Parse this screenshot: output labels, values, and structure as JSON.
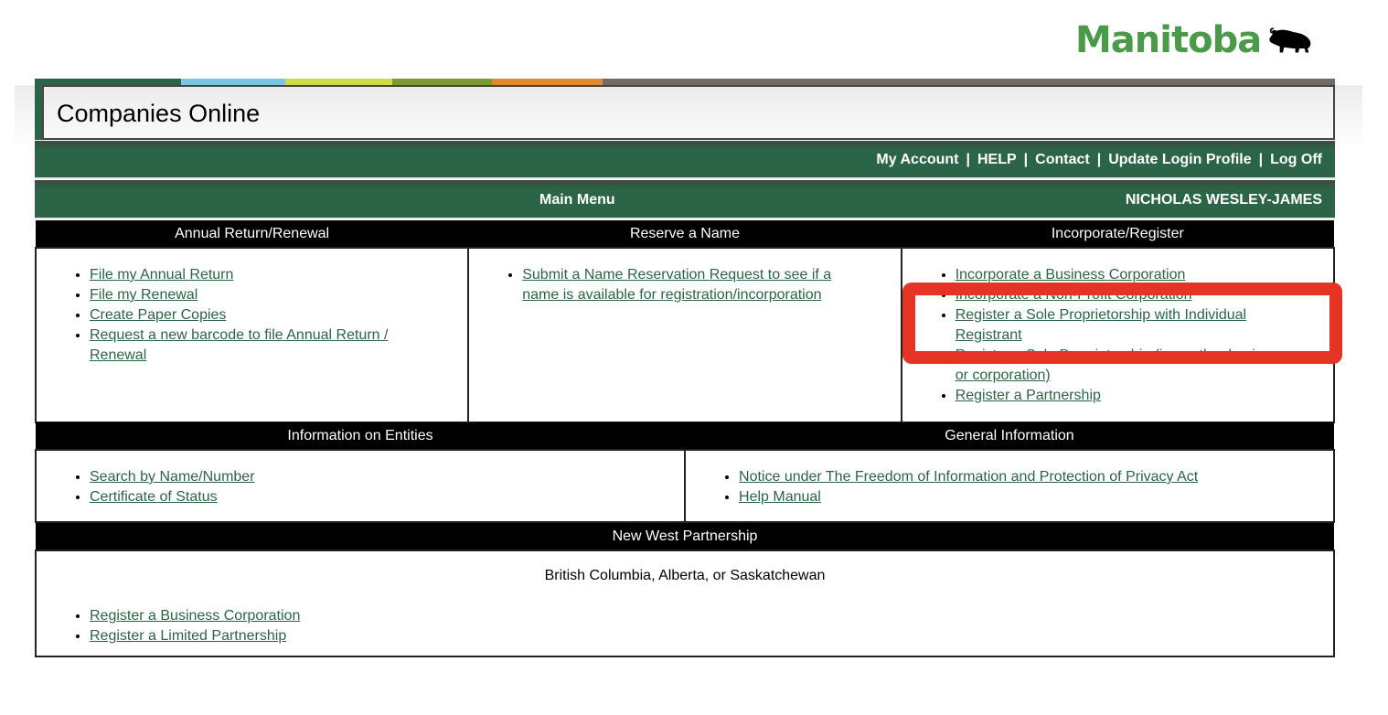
{
  "brand": {
    "logo_text": "Manitoba",
    "logo_icon": "bison-icon",
    "stripe_colors": [
      "#2c6447",
      "#7ac4e4",
      "#cfdc48",
      "#7d9a34",
      "#e08a30",
      "#736a63"
    ]
  },
  "app_title": "Companies Online",
  "top_links": [
    "My Account",
    "HELP",
    "Contact",
    "Update Login Profile",
    "Log Off"
  ],
  "menu_bar": {
    "title": "Main Menu",
    "user_name": "NICHOLAS WESLEY-JAMES"
  },
  "sections_row1": [
    {
      "header": "Annual Return/Renewal",
      "links": [
        "File my Annual Return",
        "File my Renewal",
        "Create Paper Copies",
        "Request a new barcode to file Annual Return / Renewal"
      ]
    },
    {
      "header": "Reserve a Name",
      "links": [
        "Submit a Name Reservation Request to see if a name is available for registration/incorporation"
      ]
    },
    {
      "header": "Incorporate/Register",
      "links": [
        "Incorporate a Business Corporation",
        "Incorporate a Non-Profit Corporation",
        "Register a Sole Proprietorship with Individual Registrant",
        "Register a Sole Proprietorship (in another business or corporation)",
        "Register a Partnership"
      ]
    }
  ],
  "sections_row2": [
    {
      "header": "Information on Entities",
      "links": [
        "Search by Name/Number",
        "Certificate of Status"
      ]
    },
    {
      "header": "General Information",
      "links": [
        "Notice under The Freedom of Information and Protection of Privacy Act",
        "Help Manual"
      ]
    }
  ],
  "new_west": {
    "header": "New West Partnership",
    "subtitle": "British Columbia, Alberta, or Saskatchewan",
    "links": [
      "Register a Business Corporation",
      "Register a Limited Partnership"
    ]
  },
  "colors": {
    "link": "#2c6447",
    "bar_green": "#2c6447",
    "annotation_red": "#e53426"
  }
}
